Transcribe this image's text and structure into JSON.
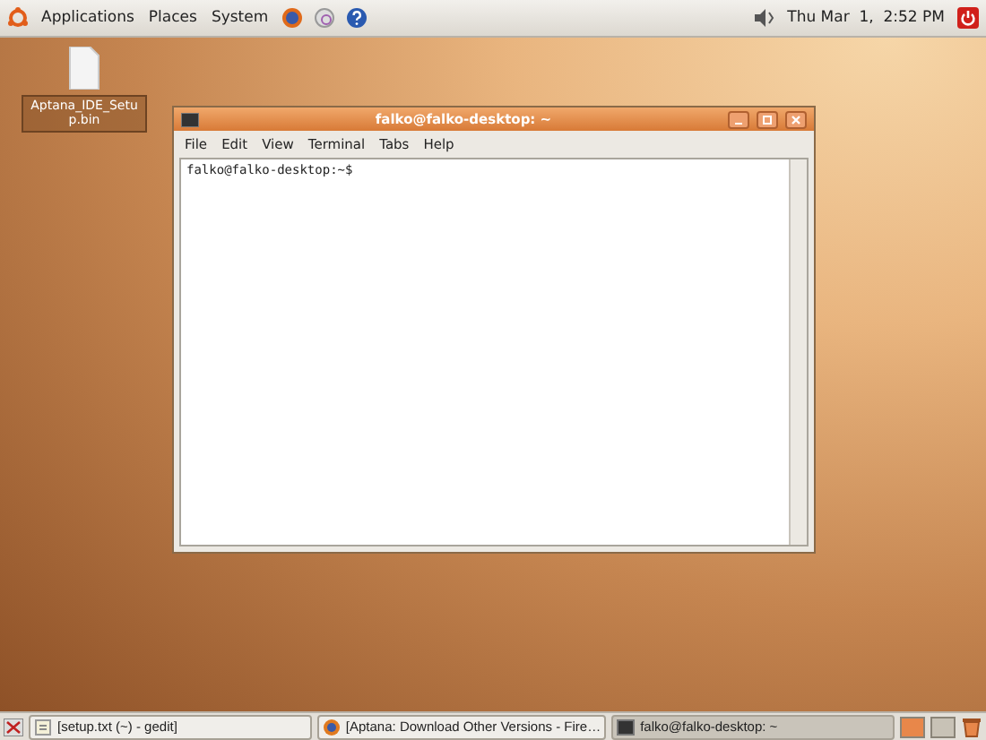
{
  "top_panel": {
    "menus": [
      "Applications",
      "Places",
      "System"
    ],
    "clock": "Thu Mar  1,  2:52 PM"
  },
  "desktop_icons": [
    {
      "label": "Aptana_IDE_Setup.bin",
      "selected": true
    }
  ],
  "terminal": {
    "title": "falko@falko-desktop: ~",
    "menu": [
      "File",
      "Edit",
      "View",
      "Terminal",
      "Tabs",
      "Help"
    ],
    "prompt": "falko@falko-desktop:~$"
  },
  "taskbar": {
    "windows": [
      {
        "label": "[setup.txt (~) - gedit]",
        "kind": "editor",
        "selected": false
      },
      {
        "label": "[Aptana: Download Other Versions - Fire…",
        "kind": "browser",
        "selected": false
      },
      {
        "label": "falko@falko-desktop: ~",
        "kind": "terminal",
        "selected": true
      }
    ],
    "workspaces": [
      {
        "selected": true
      },
      {
        "selected": false
      }
    ]
  }
}
